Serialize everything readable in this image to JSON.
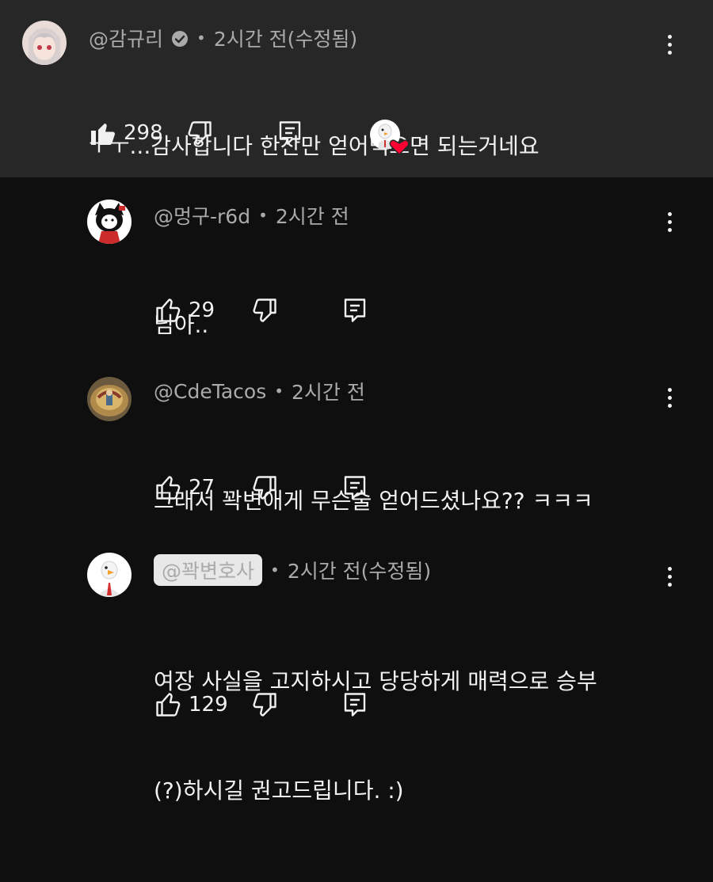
{
  "comments": [
    {
      "author": "@감규리",
      "verified": true,
      "time": "2시간 전(수정됨)",
      "lines": [
        "ㅜㅜ...감사합니다 한잔만 얻어먹으면 되는거네요"
      ],
      "likes": "298",
      "pinned_style": true,
      "creator_heart": true
    },
    {
      "author": "@멍구-r6d",
      "time": "2시간 전",
      "lines": [
        "님아.."
      ],
      "likes": "29"
    },
    {
      "author": "@CdeTacos",
      "time": "2시간 전",
      "lines": [
        "그래서 꽉변애게 무슨술 얻어드셨나요?? ㅋㅋㅋ"
      ],
      "likes": "27"
    },
    {
      "author": "@꽉변호사",
      "author_highlight": true,
      "time": "2시간 전(수정됨)",
      "lines": [
        "여장 사실을 고지하시고 당당하게 매력으로 승부",
        "(?)하시길 권고드립니다. :)"
      ],
      "likes": "129"
    }
  ],
  "separator": "•",
  "colors": {
    "background": "#0f0f0f",
    "highlight_bg": "#272727",
    "text_primary": "#f1f1f1",
    "text_secondary": "#aaaaaa",
    "heart": "#ff0033"
  },
  "icons": [
    "thumb-up-icon",
    "thumb-down-icon",
    "reply-icon",
    "more-vert-icon",
    "verified-icon",
    "creator-heart-icon"
  ]
}
